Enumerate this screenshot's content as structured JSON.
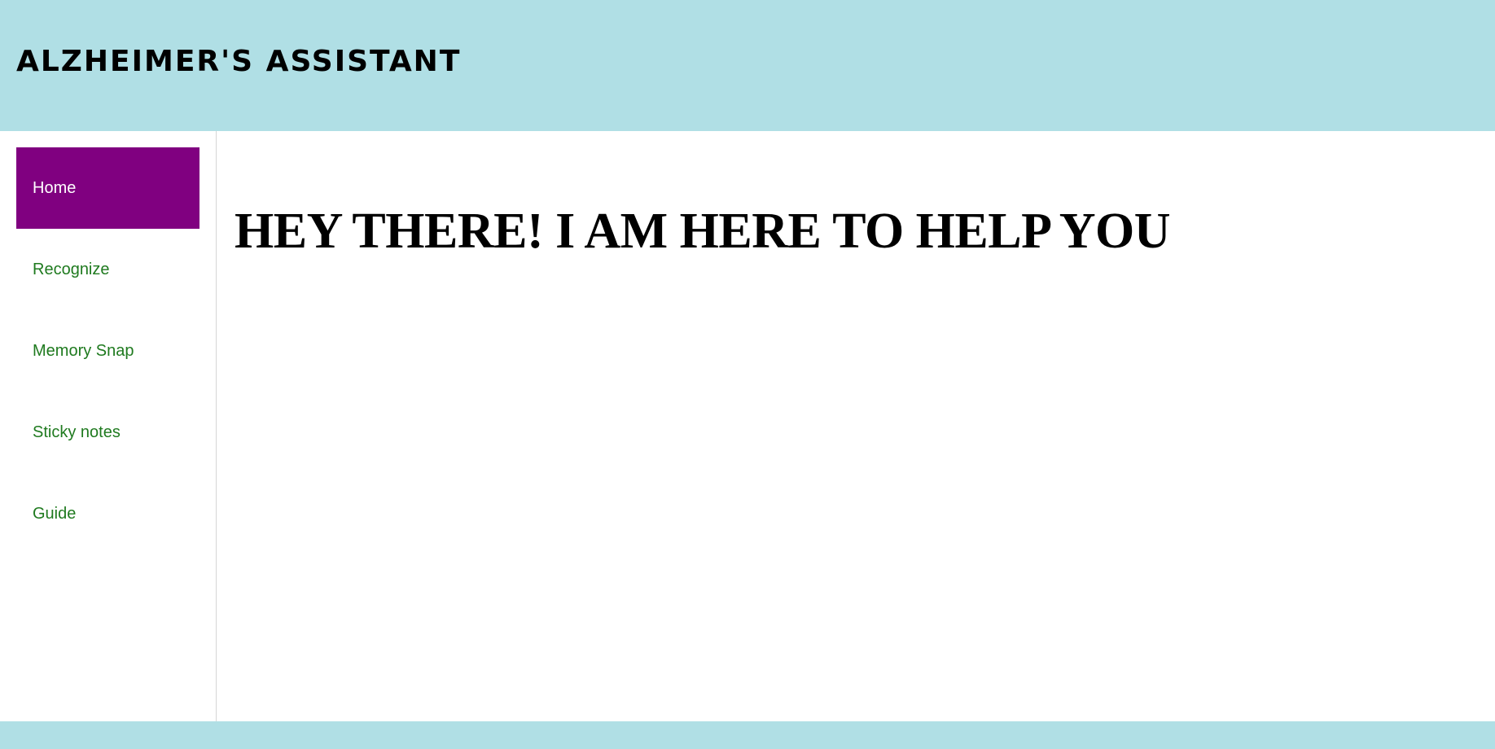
{
  "header": {
    "title": "ALZHEIMER'S ASSISTANT"
  },
  "sidebar": {
    "items": [
      {
        "label": "Home",
        "active": true
      },
      {
        "label": "Recognize",
        "active": false
      },
      {
        "label": "Memory Snap",
        "active": false
      },
      {
        "label": "Sticky notes",
        "active": false
      },
      {
        "label": "Guide",
        "active": false
      }
    ]
  },
  "main": {
    "heading": "HEY THERE! I AM HERE TO HELP YOU"
  },
  "footer": {
    "text": ""
  },
  "colors": {
    "header_bg": "#b0dfe5",
    "nav_active_bg": "#800080",
    "nav_active_text": "#ffffff",
    "nav_link_text": "#1f7a1f"
  }
}
